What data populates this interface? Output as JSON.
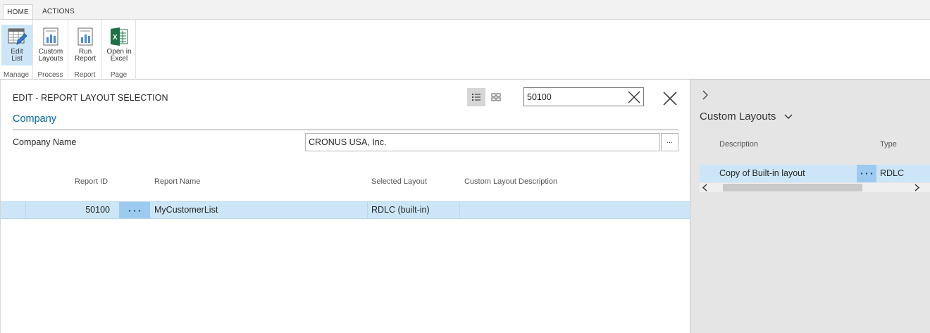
{
  "ribbon": {
    "tabs": [
      "HOME",
      "ACTIONS"
    ],
    "groups": [
      {
        "label": "Manage",
        "buttons": [
          {
            "line1": "Edit",
            "line2": "List",
            "icon": "edit-list-icon"
          }
        ]
      },
      {
        "label": "Process",
        "buttons": [
          {
            "line1": "Custom",
            "line2": "Layouts",
            "icon": "report-icon"
          }
        ]
      },
      {
        "label": "Report",
        "buttons": [
          {
            "line1": "Run",
            "line2": "Report",
            "icon": "report-icon"
          }
        ]
      },
      {
        "label": "Page",
        "buttons": [
          {
            "line1": "Open in",
            "line2": "Excel",
            "icon": "excel-icon"
          }
        ]
      }
    ]
  },
  "page": {
    "title": "EDIT - REPORT LAYOUT SELECTION",
    "search_value": "50100",
    "section_title": "Company",
    "company_label": "Company Name",
    "company_value": "CRONUS USA, Inc.",
    "lookup_label": "..."
  },
  "grid": {
    "columns": [
      "Report ID",
      "Report Name",
      "Selected Layout",
      "Custom Layout Description"
    ],
    "rows": [
      {
        "report_id": "50100",
        "report_name": "MyCustomerList",
        "selected_layout": "RDLC (built-in)",
        "custom_layout_description": ""
      }
    ]
  },
  "factbox": {
    "title": "Custom Layouts",
    "columns": [
      "Description",
      "Type"
    ],
    "rows": [
      {
        "description": "Copy of Built-in layout",
        "type": "RDLC"
      }
    ]
  },
  "colors": {
    "accent": "#00689e",
    "selection": "#cde6f7",
    "selection_strong": "#9ccbef",
    "excel_green": "#1e7145"
  }
}
